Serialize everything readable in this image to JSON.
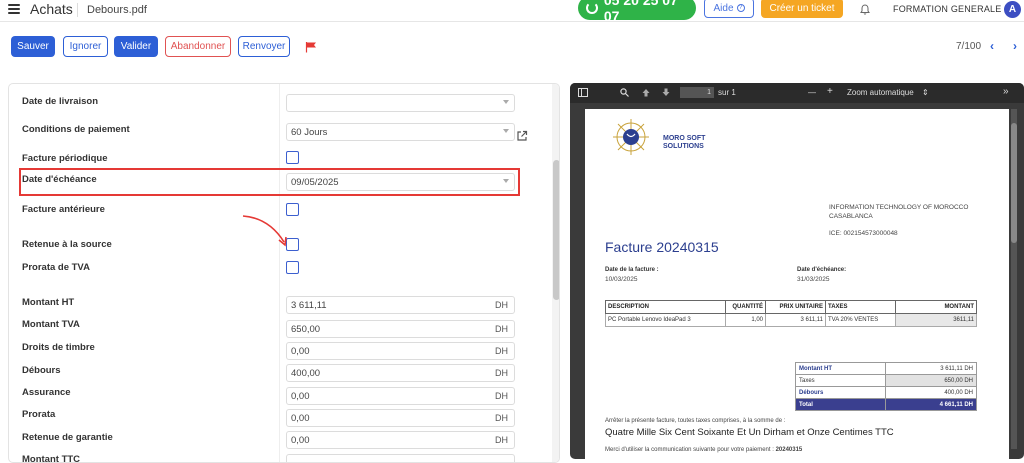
{
  "header": {
    "app_title": "Achats",
    "file_name": "Debours.pdf",
    "phone": "05 20 25 07 07",
    "help_label": "Aide",
    "ticket_label": "Créer un ticket",
    "company": "FORMATION GENERALE",
    "avatar_letter": "A"
  },
  "toolbar": {
    "save": "Sauver",
    "ignore": "Ignorer",
    "validate": "Valider",
    "abandon": "Abandonner",
    "resend": "Renvoyer",
    "pager": "7/100",
    "prev": "‹",
    "next": "›"
  },
  "form": {
    "delivery_date": {
      "label": "Date de livraison",
      "value": ""
    },
    "payment_terms": {
      "label": "Conditions de paiement",
      "value": "60 Jours"
    },
    "periodic_invoice": {
      "label": "Facture périodique"
    },
    "due_date": {
      "label": "Date d'échéance",
      "value": "09/05/2025"
    },
    "previous_invoice": {
      "label": "Facture antérieure"
    },
    "withholding": {
      "label": "Retenue à la source"
    },
    "vat_prorata": {
      "label": "Prorata de TVA"
    },
    "amount_ht": {
      "label": "Montant HT",
      "value": "3 611,11",
      "unit": "DH"
    },
    "amount_tva": {
      "label": "Montant TVA",
      "value": "650,00",
      "unit": "DH"
    },
    "stamp_duty": {
      "label": "Droits de timbre",
      "value": "0,00",
      "unit": "DH"
    },
    "disbursements": {
      "label": "Débours",
      "value": "400,00",
      "unit": "DH"
    },
    "insurance": {
      "label": "Assurance",
      "value": "0,00",
      "unit": "DH"
    },
    "prorata": {
      "label": "Prorata",
      "value": "0,00",
      "unit": "DH"
    },
    "guarantee": {
      "label": "Retenue de garantie",
      "value": "0,00",
      "unit": "DH"
    },
    "amount_ttc": {
      "label": "Montant TTC"
    }
  },
  "pdf": {
    "page": "1",
    "page_of": "sur 1",
    "zoom": "Zoom automatique",
    "zoom_minus": "—",
    "zoom_plus": "+",
    "logo_line1": "MORO SOFT",
    "logo_line2": "SOLUTIONS",
    "recipient_line1": "INFORMATION TECHNOLOGY OF MOROCCO",
    "recipient_line2": "CASABLANCA",
    "ice": "ICE: 002154573000048",
    "invoice_title": "Facture 20240315",
    "invoice_date_label": "Date de la facture :",
    "invoice_date": "10/03/2025",
    "due_date_label": "Date d'échéance:",
    "due_date": "31/03/2025",
    "table_headers": [
      "DESCRIPTION",
      "QUANTITÉ",
      "PRIX UNITAIRE",
      "TAXES",
      "MONTANT"
    ],
    "table_row": [
      "PC Portable Lenovo IdeaPad 3",
      "1,00",
      "3 611,11",
      "TVA 20% VENTES",
      "3611,11"
    ],
    "totals": [
      {
        "label": "Montant HT",
        "value": "3 611,11 DH"
      },
      {
        "label": "Taxes",
        "value": "650,00 DH"
      },
      {
        "label": "Débours",
        "value": "400,00 DH"
      },
      {
        "label": "Total",
        "value": "4 661,11 DH"
      }
    ],
    "closing_line": "Arrêter la présente facture, toutes taxes comprises, à la somme de :",
    "amount_words": "Quatre Mille Six Cent Soixante Et Un Dirham et Onze Centimes TTC",
    "payment_ref_prefix": "Merci d'utiliser la communication suivante pour votre paiement :",
    "payment_ref": "20240315"
  },
  "colors": {
    "primary": "#2d5fd6",
    "danger": "#e05252",
    "phone_green": "#2fb348",
    "ticket_orange": "#f5a623",
    "highlight_red": "#e53935"
  }
}
